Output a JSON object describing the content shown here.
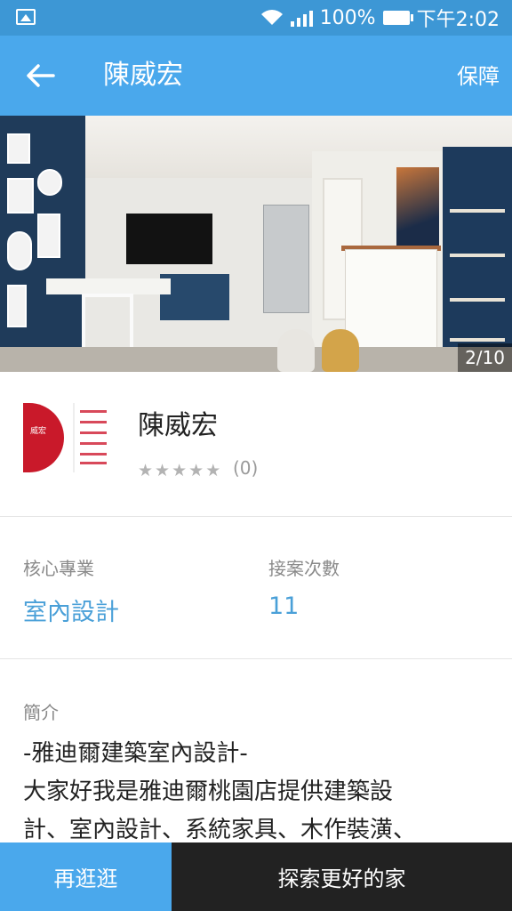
{
  "status_bar": {
    "battery": "100%",
    "time": "下午2:02"
  },
  "app_bar": {
    "title": "陳威宏",
    "action_label": "保障"
  },
  "gallery": {
    "counter": "2/10"
  },
  "profile": {
    "name": "陳威宏",
    "rating_stars": 0,
    "rating_count": "(0)"
  },
  "stats": {
    "specialty_label": "核心專業",
    "specialty_value": "室內設計",
    "jobs_label": "接案次數",
    "jobs_value": "11"
  },
  "intro": {
    "label": "簡介",
    "text": "-雅迪爾建築室內設計-\n大家好我是雅迪爾桃園店提供建築設\n計、室內設計、系統家具、木作裝潢、"
  },
  "bottom_bar": {
    "left_label": "再逛逛",
    "right_label": "探索更好的家"
  },
  "colors": {
    "status_bar": "#3d97d5",
    "app_bar": "#4aa8ec",
    "accent_text": "#4aa0d8",
    "dark_button": "#222222"
  }
}
